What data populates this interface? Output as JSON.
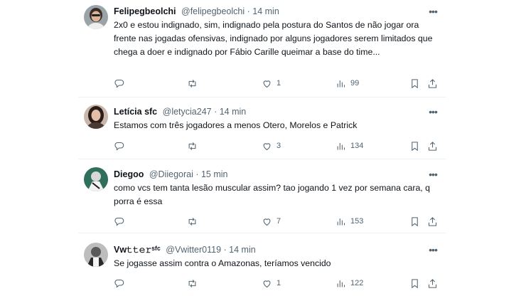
{
  "tweets": [
    {
      "display_name": "Felipegbeolchi",
      "handle": "@felipegbeolchi",
      "time": "14 min",
      "text": "2x0 e estou indignado, sim, indignado pela postura do Santos de não jogar ora frente nas jogadas ofensivas, indignado por alguns jogadores serem limitados que chega a doer e indignado por Fábio Carille queimar a base do time...",
      "replies": "",
      "retweets": "",
      "likes": "1",
      "views": "99"
    },
    {
      "display_name": "Letícia sfc",
      "handle": "@letycia247",
      "time": "14 min",
      "text": "Estamos com três jogadores a menos Otero, Morelos e Patrick",
      "replies": "",
      "retweets": "",
      "likes": "3",
      "views": "134"
    },
    {
      "display_name": "Diegoo",
      "handle": "@Diiegorai",
      "time": "15 min",
      "text": "como vcs tem tanta lesão muscular assim? tao jogando 1 vez por semana cara, q porra é essa",
      "replies": "",
      "retweets": "",
      "likes": "7",
      "views": "153"
    },
    {
      "display_name": "Vw𝚝𝚝𝚎𝚛ˢᶠᶜ",
      "handle": "@Vwitter0119",
      "time": "14 min",
      "text": "Se jogasse assim contra o Amazonas, teríamos vencido",
      "replies": "",
      "retweets": "",
      "likes": "1",
      "views": "122"
    }
  ],
  "separator": " · ",
  "more_glyph": "•••",
  "icons": [
    "reply-icon",
    "retweet-icon",
    "like-icon",
    "views-icon",
    "bookmark-icon",
    "share-icon"
  ],
  "colors": {
    "text": "#0f1419",
    "secondary": "#536471",
    "divider": "#eff3f4"
  }
}
